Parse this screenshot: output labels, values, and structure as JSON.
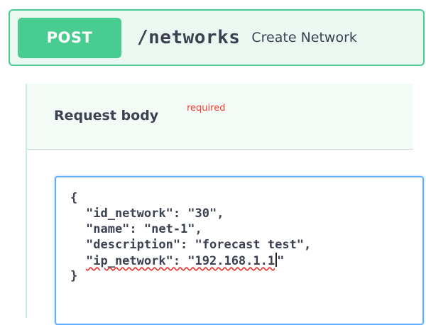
{
  "operation": {
    "method": "POST",
    "path": "/networks",
    "summary": "Create Network",
    "method_color": "#49cc90"
  },
  "request_body": {
    "title": "Request body",
    "required_label": "required"
  },
  "editor": {
    "lines": [
      "{",
      "\"id_network\": \"30\",",
      "\"name\": \"net-1\",",
      "\"description\": \"forecast test\",",
      "\"ip_network\": \"192.168.1.1\"",
      "}"
    ],
    "caret_line": 4,
    "highlight_color": "#61affe"
  }
}
